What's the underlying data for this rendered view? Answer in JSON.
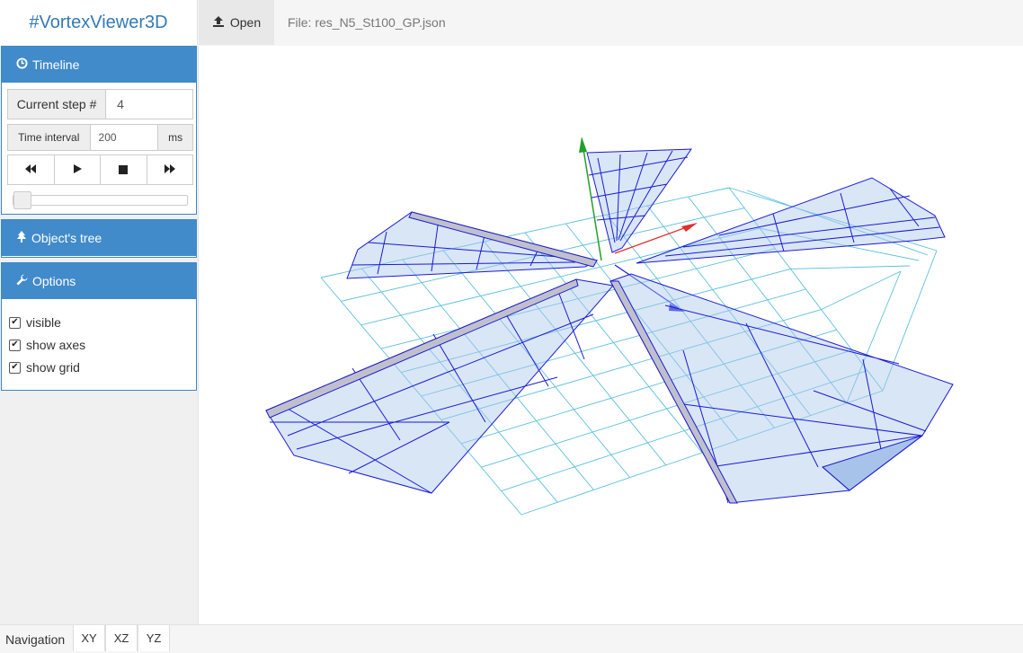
{
  "app": {
    "title": "#VortexViewer3D"
  },
  "toolbar": {
    "open_label": "Open",
    "file_label": "File: res_N5_St100_GP.json",
    "open_icon": "upload-icon"
  },
  "timeline": {
    "header": "Timeline",
    "step_label": "Current step #",
    "step_value": "4",
    "interval_label": "Time interval",
    "interval_value": "200",
    "interval_unit": "ms",
    "controls": [
      "rewind",
      "play",
      "stop",
      "fast-forward"
    ],
    "slider_progress": 0
  },
  "tree": {
    "header": "Object's tree"
  },
  "options": {
    "header": "Options",
    "items": [
      {
        "label": "visible",
        "checked": true
      },
      {
        "label": "show axes",
        "checked": true
      },
      {
        "label": "show grid",
        "checked": true
      }
    ]
  },
  "navigation": {
    "label": "Navigation",
    "views": [
      "XY",
      "XZ",
      "YZ"
    ]
  },
  "colors": {
    "accent": "#428bca",
    "brand": "#337ab7",
    "grid": "#5bc0de",
    "wire": "#1a1ad6",
    "fill": "#c8dcf2"
  }
}
